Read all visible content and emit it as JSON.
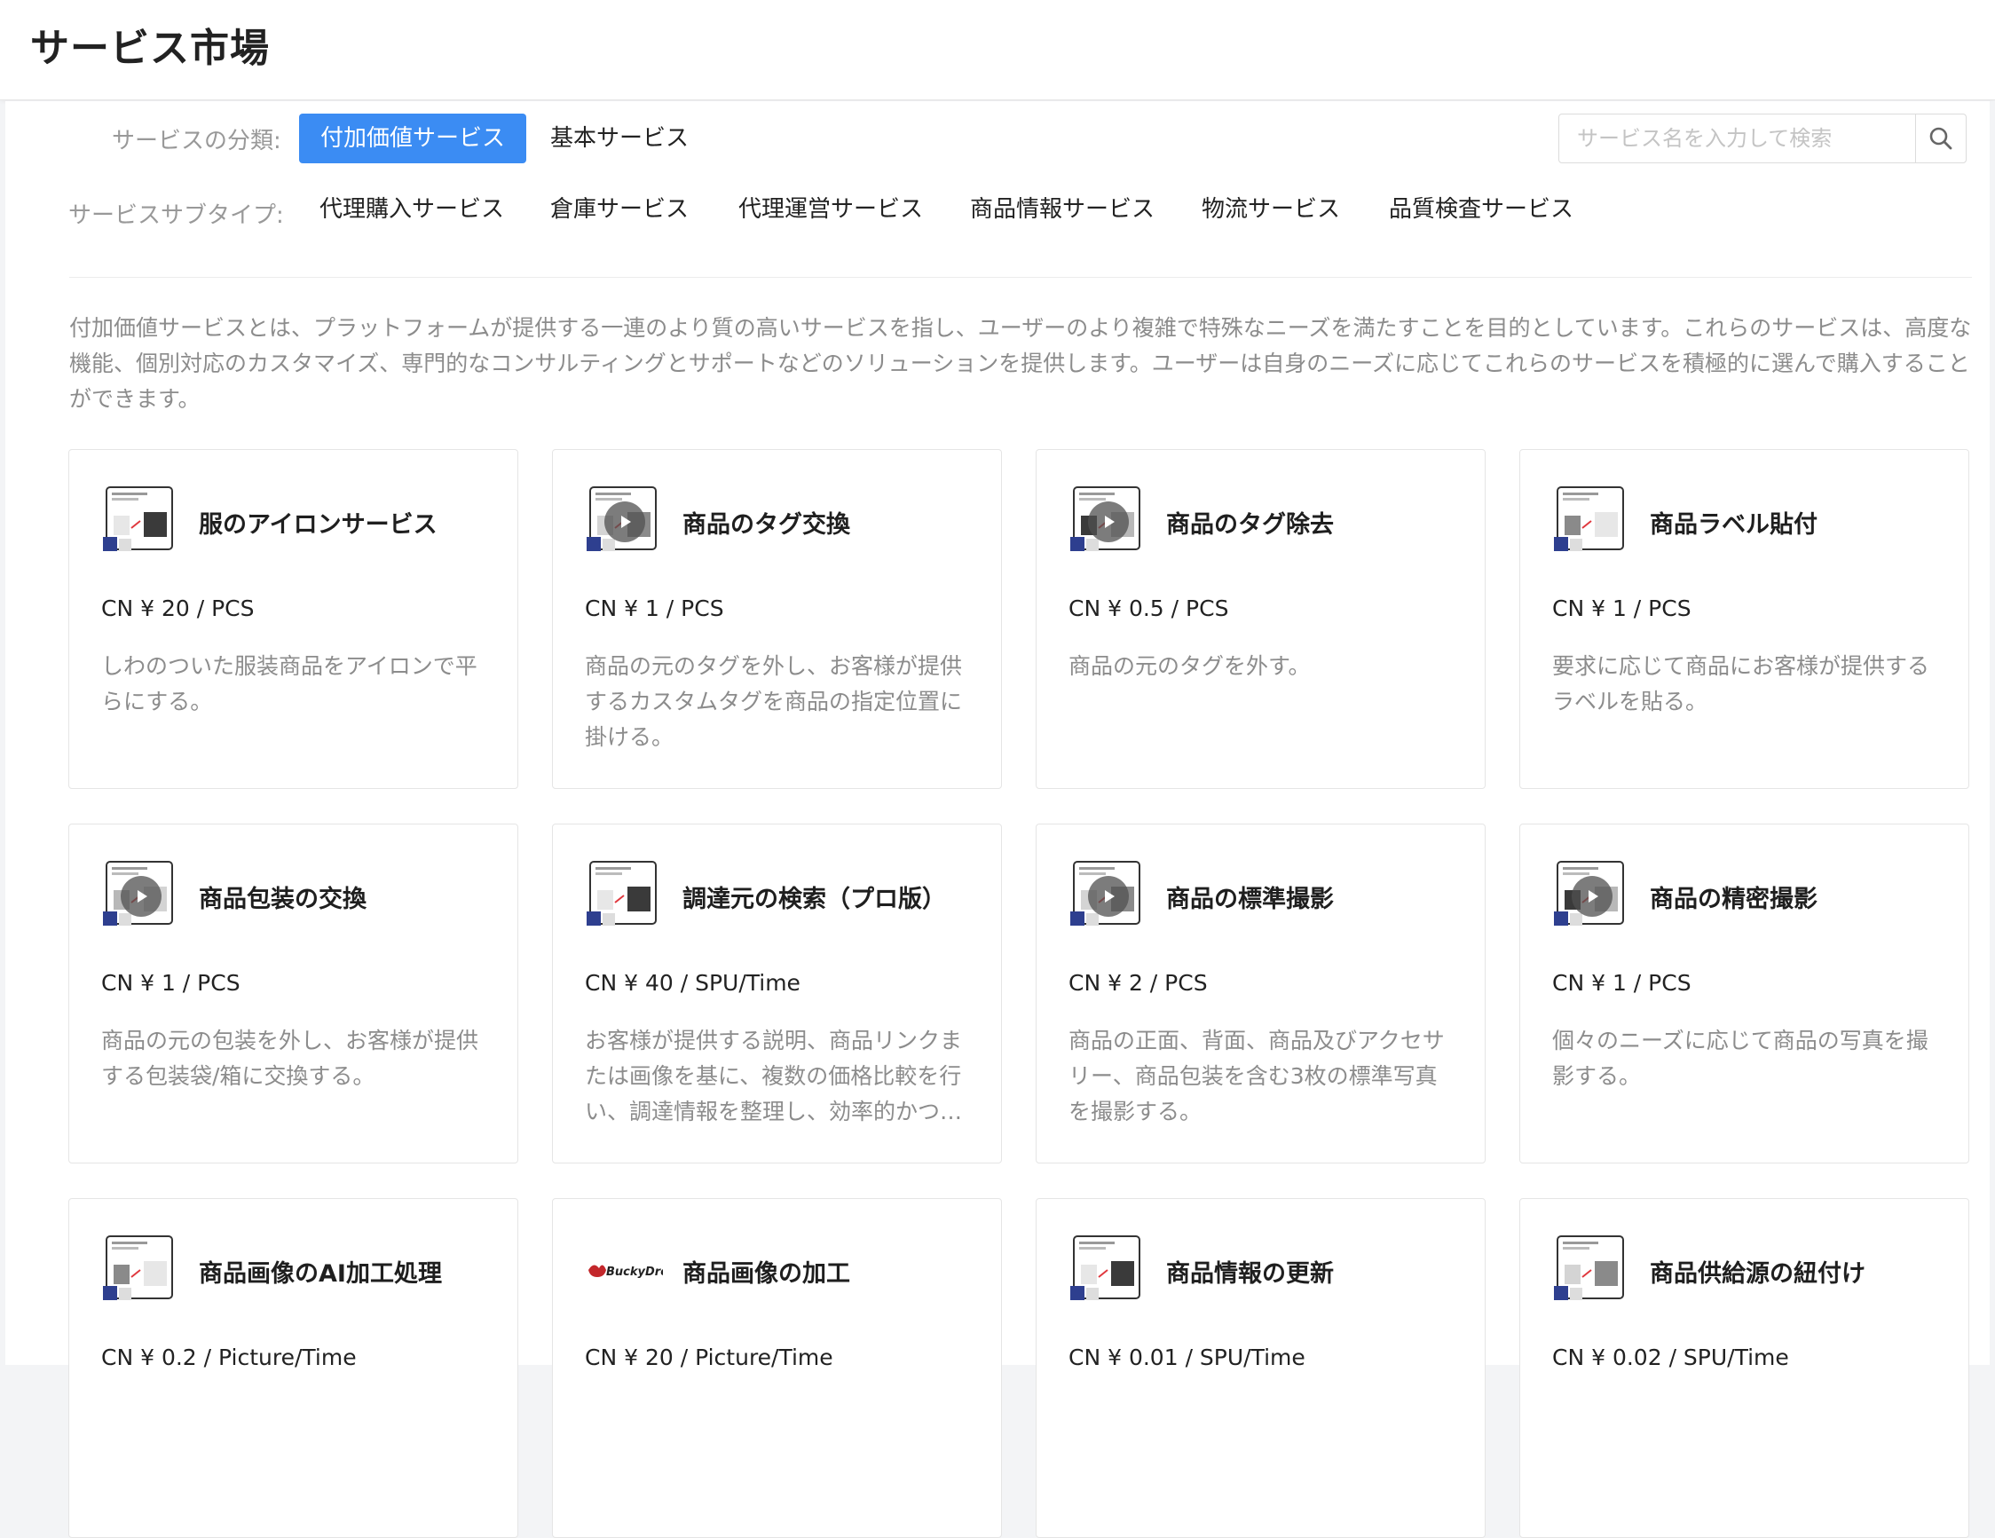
{
  "header": {
    "title": "サービス市場"
  },
  "filters": {
    "category_label": "サービスの分類:",
    "categories": [
      {
        "label": "付加価値サービス",
        "active": true
      },
      {
        "label": "基本サービス",
        "active": false
      }
    ],
    "subtype_label": "サービスサブタイプ:",
    "subtypes": [
      "代理購入サービス",
      "倉庫サービス",
      "代理運営サービス",
      "商品情報サービス",
      "物流サービス",
      "品質検査サービス"
    ]
  },
  "search": {
    "placeholder": "サービス名を入力して検索"
  },
  "intro": "付加価値サービスとは、プラットフォームが提供する一連のより質の高いサービスを指し、ユーザーのより複雑で特殊なニーズを満たすことを目的としています。これらのサービスは、高度な機能、個別対応のカスタマイズ、専門的なコンサルティングとサポートなどのソリューションを提供します。ユーザーは自身のニーズに応じてこれらのサービスを積極的に選んで購入することができます。",
  "accent_color": "#3b8cf3",
  "services": [
    {
      "title": "服のアイロンサービス",
      "price": "CN ¥ 20 / PCS",
      "desc": "しわのついた服装商品をアイロンで平らにする。",
      "icon": "ironing-thumbnail",
      "video": false
    },
    {
      "title": "商品のタグ交換",
      "price": "CN ¥ 1 / PCS",
      "desc": "商品の元のタグを外し、お客様が提供するカスタムタグを商品の指定位置に掛ける。",
      "icon": "tag-swap-thumbnail",
      "video": true
    },
    {
      "title": "商品のタグ除去",
      "price": "CN ¥ 0.5 / PCS",
      "desc": "商品の元のタグを外す。",
      "icon": "tag-remove-thumbnail",
      "video": true
    },
    {
      "title": "商品ラベル貼付",
      "price": "CN ¥ 1 / PCS",
      "desc": "要求に応じて商品にお客様が提供するラベルを貼る。",
      "icon": "label-thumbnail",
      "video": false
    },
    {
      "title": "商品包装の交換",
      "price": "CN ¥ 1 / PCS",
      "desc": "商品の元の包装を外し、お客様が提供する包装袋/箱に交換する。",
      "icon": "repack-thumbnail",
      "video": true
    },
    {
      "title": "調達元の検索（プロ版）",
      "price": "CN ¥ 40 / SPU/Time",
      "desc": "お客様が提供する説明、商品リンクまたは画像を基に、複数の価格比較を行い、調達情報を整理し、効率的かつ…",
      "icon": "sourcing-thumbnail",
      "video": false
    },
    {
      "title": "商品の標準撮影",
      "price": "CN ¥ 2 / PCS",
      "desc": "商品の正面、背面、商品及びアクセサリー、商品包装を含む3枚の標準写真を撮影する。",
      "icon": "photo-standard-thumbnail",
      "video": true
    },
    {
      "title": "商品の精密撮影",
      "price": "CN ¥ 1 / PCS",
      "desc": "個々のニーズに応じて商品の写真を撮影する。",
      "icon": "photo-detail-thumbnail",
      "video": true
    },
    {
      "title": "商品画像のAI加工処理",
      "price": "CN ¥ 0.2 / Picture/Time",
      "desc": "",
      "icon": "ai-image-thumbnail",
      "video": false
    },
    {
      "title": "商品画像の加工",
      "price": "CN ¥ 20 / Picture/Time",
      "desc": "",
      "icon": "buckydrop-logo",
      "logo_text": "BuckyDrop",
      "video": false
    },
    {
      "title": "商品情報の更新",
      "price": "CN ¥ 0.01 / SPU/Time",
      "desc": "",
      "icon": "info-update-thumbnail",
      "video": false
    },
    {
      "title": "商品供給源の紐付け",
      "price": "CN ¥ 0.02 / SPU/Time",
      "desc": "",
      "icon": "source-link-thumbnail",
      "video": false
    }
  ]
}
